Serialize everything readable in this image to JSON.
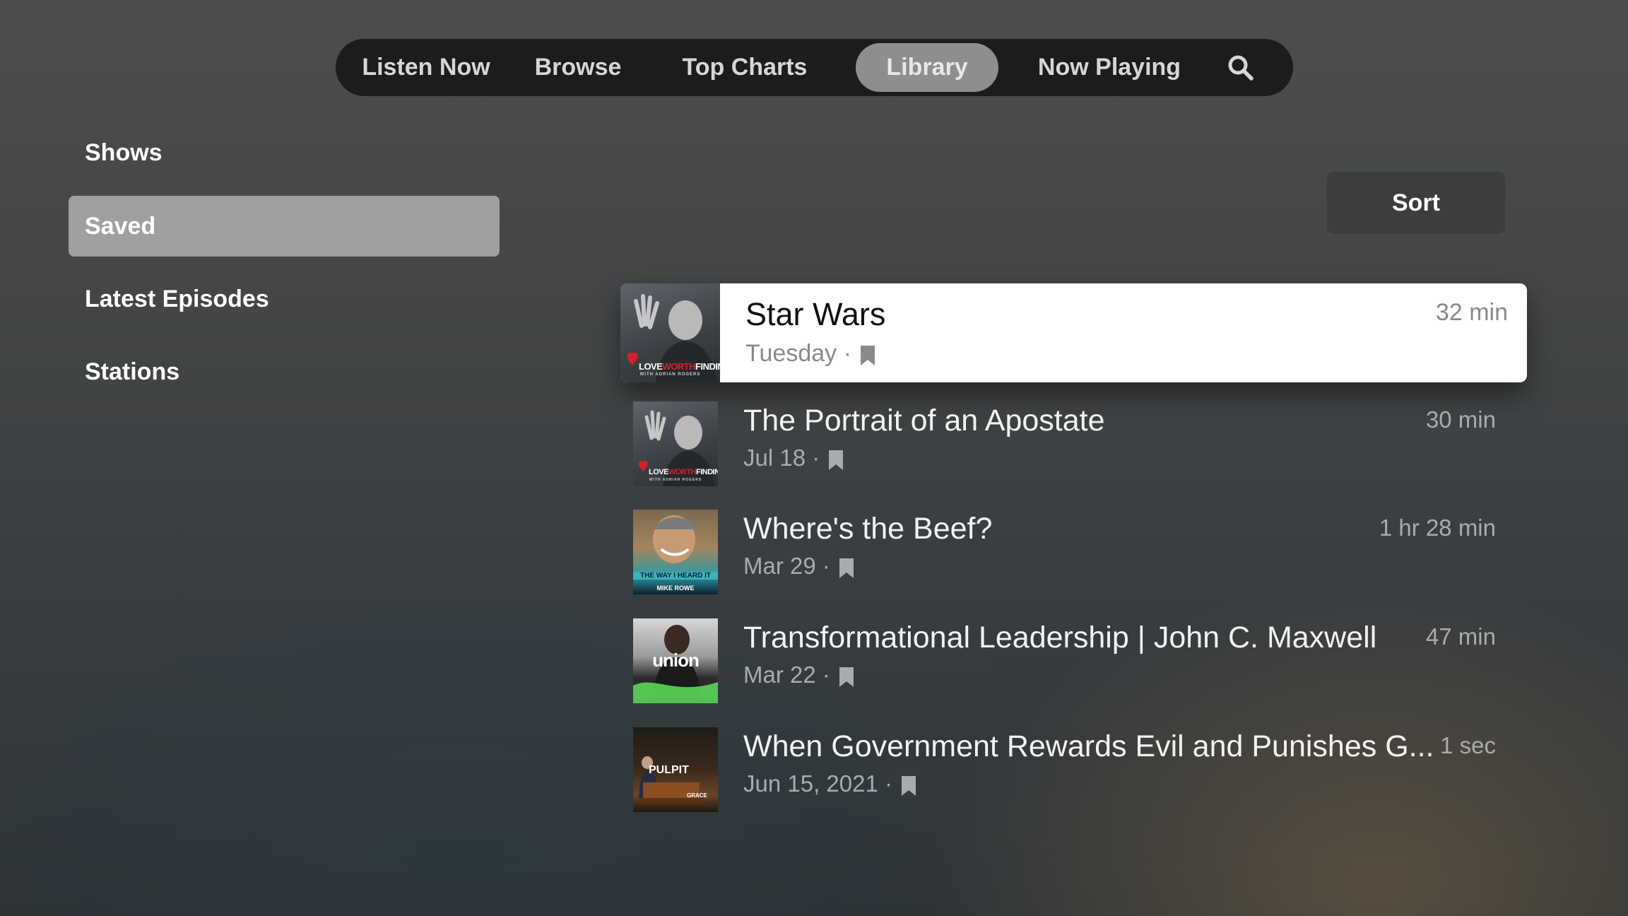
{
  "tabs": [
    {
      "label": "Listen Now",
      "active": false
    },
    {
      "label": "Browse",
      "active": false
    },
    {
      "label": "Top Charts",
      "active": false
    },
    {
      "label": "Library",
      "active": true
    },
    {
      "label": "Now Playing",
      "active": false
    }
  ],
  "search_icon": "search-icon",
  "sidebar": {
    "items": [
      {
        "label": "Shows",
        "active": false
      },
      {
        "label": "Saved",
        "active": true
      },
      {
        "label": "Latest Episodes",
        "active": false
      },
      {
        "label": "Stations",
        "active": false
      }
    ]
  },
  "sort": {
    "label": "Sort"
  },
  "episodes": [
    {
      "title": "Star Wars",
      "date": "Tuesday",
      "duration": "32 min",
      "saved_icon": "bookmark-icon",
      "artwork": "Love Worth Finding with Adrian Rogers",
      "focused": true
    },
    {
      "title": "The Portrait of an Apostate",
      "date": "Jul 18",
      "duration": "30 min",
      "saved_icon": "bookmark-icon",
      "artwork": "Love Worth Finding with Adrian Rogers",
      "focused": false
    },
    {
      "title": "Where's the Beef?",
      "date": "Mar 29",
      "duration": "1 hr 28 min",
      "saved_icon": "bookmark-icon",
      "artwork": "The Way I Heard It with Mike Rowe",
      "focused": false
    },
    {
      "title": "Transformational Leadership | John C. Maxwell",
      "date": "Mar 22",
      "duration": "47 min",
      "saved_icon": "bookmark-icon",
      "artwork": "Union",
      "focused": false
    },
    {
      "title": "When Government Rewards Evil and Punishes G...",
      "date": "Jun 15, 2021",
      "duration": "1 sec",
      "saved_icon": "bookmark-icon",
      "artwork": "Pulpit Grace to You",
      "focused": false
    }
  ],
  "artwork_text": {
    "lwf_a": "LOVE",
    "lwf_b": "WORTH",
    "lwf_c": "FINDING",
    "lwf_sub": "WITH ADRIAN ROGERS",
    "wayheard_a": "THE WAY I HEARD IT",
    "wayheard_b": "MIKE ROWE",
    "union": "union",
    "pulpit": "PULPIT",
    "grace": "GRACE"
  },
  "separator": "·"
}
